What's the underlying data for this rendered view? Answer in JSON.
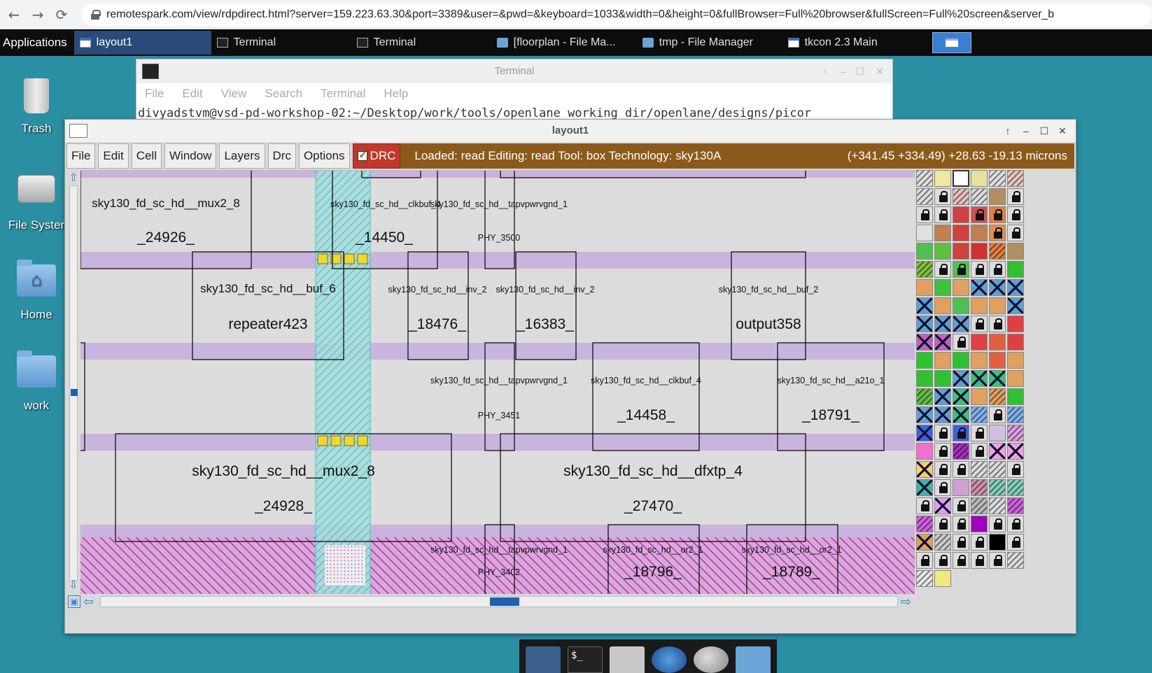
{
  "browser": {
    "url": "remotespark.com/view/rdpdirect.html?server=159.223.63.30&port=3389&user=&pwd=&keyboard=1033&width=0&height=0&fullBrowser=Full%20browser&fullScreen=Full%20screen&server_b"
  },
  "taskbar": {
    "apps_label": "Applications",
    "tasks": [
      {
        "label": "layout1",
        "icon": "window-icon"
      },
      {
        "label": "Terminal",
        "icon": "terminal-icon"
      },
      {
        "label": "Terminal",
        "icon": "terminal-icon"
      },
      {
        "label": "[floorplan - File Ma...",
        "icon": "folder-icon"
      },
      {
        "label": "tmp - File Manager",
        "icon": "folder-icon"
      },
      {
        "label": "tkcon 2.3 Main",
        "icon": "window-icon"
      }
    ]
  },
  "desktop": {
    "icons": [
      {
        "label": "Trash",
        "icon": "trash-icon"
      },
      {
        "label": "File Syster",
        "icon": "drive-icon"
      },
      {
        "label": "Home",
        "icon": "home-folder-icon"
      },
      {
        "label": "work",
        "icon": "folder-icon"
      }
    ]
  },
  "bg_terminal": {
    "title": "Terminal",
    "menu": [
      "File",
      "Edit",
      "View",
      "Search",
      "Terminal",
      "Help"
    ],
    "prompt": "divyadstvm@vsd-pd-workshop-02:~/Desktop/work/tools/openlane_working_dir/openlane/designs/picor"
  },
  "layout_window": {
    "title": "layout1",
    "menu": [
      "File",
      "Edit",
      "Cell",
      "Window",
      "Layers",
      "Drc",
      "Options"
    ],
    "drc_label": "DRC",
    "status_text": "Loaded: read Editing: read Tool: box  Technology: sky130A",
    "coords_text": "(+341.45 +334.49) +28.63 -19.13 microns"
  },
  "colors": {
    "rail": "#c8b4dc",
    "cell_bg": "#dcdcdc",
    "status": "#8b5a1b",
    "drc": "#c0392b",
    "metal_hatch": "#a020a0",
    "cyan": "#3cc8c8"
  },
  "cells": [
    {
      "type": "sky130_fd_sc_hd__mux2_8",
      "inst": "_24926_"
    },
    {
      "type": "sky130_fd_sc_hd__clkbuf_4",
      "inst": "_14450_"
    },
    {
      "type": "sky130_fd_sc_hd__tapvpwrvgnd_1",
      "inst": "PHY_3500"
    },
    {
      "type": "sky130_fd_sc_hd__buf_6",
      "inst": "repeater423"
    },
    {
      "type": "sky130_fd_sc_hd__inv_2",
      "inst": "_18476_"
    },
    {
      "type": "sky130_fd_sc_hd__inv_2",
      "inst": "_16383_"
    },
    {
      "type": "sky130_fd_sc_hd__buf_2",
      "inst": "output358"
    },
    {
      "type": "sky130_fd_sc_hd__tapvpwrvgnd_1",
      "inst": "PHY_3451"
    },
    {
      "type": "sky130_fd_sc_hd__clkbuf_4",
      "inst": "_14458_"
    },
    {
      "type": "sky130_fd_sc_hd__a21o_1",
      "inst": "_18791_"
    },
    {
      "type": "sky130_fd_sc_hd__mux2_8",
      "inst": "_24928_"
    },
    {
      "type": "sky130_fd_sc_hd__dfxtp_4",
      "inst": "_27470_"
    },
    {
      "type": "sky130_fd_sc_hd__tapvpwrvgnd_1",
      "inst": "PHY_3402"
    },
    {
      "type": "sky130_fd_sc_hd__or2_1",
      "inst": "_18796_"
    },
    {
      "type": "sky130_fd_sc_hd__or2_1",
      "inst": "_18789_"
    }
  ]
}
